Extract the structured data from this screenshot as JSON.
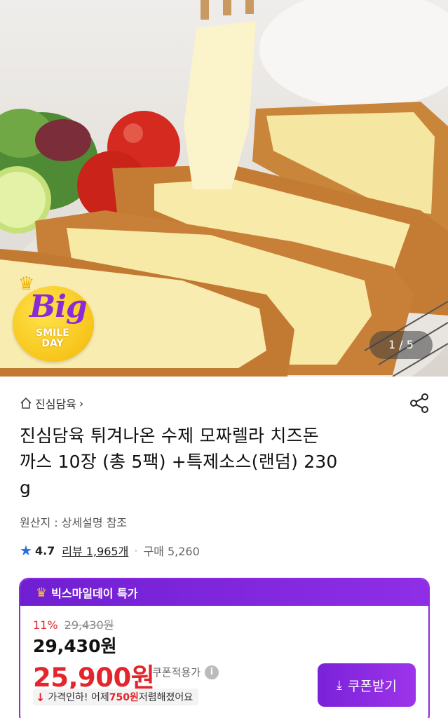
{
  "hero": {
    "badge": {
      "big": "Big",
      "smile": "SMILE",
      "day": "DAY",
      "crown_icon": "crown-icon"
    },
    "page_indicator": "1 / 5"
  },
  "product": {
    "store_name": "진심담육",
    "store_chevron": "›",
    "title_line1": "진심담육 튀겨나온 수제 모짜렐라 치즈돈",
    "title_line2": "까스 10장 (총 5팩) +특제소스(랜덤) 230",
    "title_line3": "g",
    "origin": "원산지 : 상세설명 참조",
    "rating": "4.7",
    "review_label": "리뷰 1,965개",
    "purchase_label": "구매 5,260"
  },
  "promo": {
    "header": "빅스마일데이 특가",
    "discount_pct": "11%",
    "original_price": "29,430원",
    "price": "29,430원",
    "sale_price": "25,900원",
    "coupon_note": "쿠폰적용가",
    "drop_prefix": "가격인하! 어제 ",
    "drop_amount": "750원",
    "drop_suffix": " 저렴해졌어요",
    "coupon_button": "쿠폰받기"
  },
  "colors": {
    "accent_purple": "#8b2be2",
    "sale_red": "#e3262e",
    "star_blue": "#2a6fe0",
    "badge_yellow": "#f7c51c"
  }
}
